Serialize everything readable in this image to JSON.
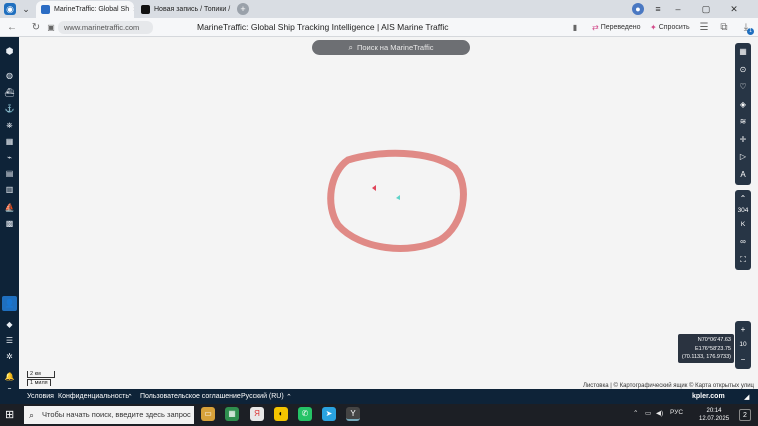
{
  "browser": {
    "tabs": [
      {
        "label": "MarineTraffic: Global Sh",
        "active": true
      },
      {
        "label": "Новая запись / Топики / ",
        "active": false
      }
    ],
    "new_tab_icon": "plus-icon",
    "url": "www.marinetraffic.com",
    "page_title": "MarineTraffic: Global Ship Tracking Intelligence | AIS Marine Traffic",
    "translated_label": "Переведено",
    "ask_label": "Спросить",
    "download_badge": "1"
  },
  "sidebar": {
    "items": [
      "logo-icon",
      "globe-icon",
      "ship-icon",
      "anchor-icon",
      "port-icon",
      "fleet-icon",
      "route-icon",
      "vessel-list-icon",
      "fleet-list-icon",
      "voyage-icon",
      "table-icon"
    ],
    "bottom_items": [
      "user-icon",
      "tag-icon",
      "layers-icon",
      "settings-icon",
      "notification-icon",
      "help-icon"
    ]
  },
  "search": {
    "placeholder": "Поиск на MarineTraffic"
  },
  "map": {
    "annotation_color": "#e08a86",
    "vessel_colors": [
      "#e0455a",
      "#5fd3c9"
    ]
  },
  "right_toolbar": {
    "zoom_in": "+",
    "zoom_level": "10",
    "zoom_out": "−",
    "heading_value": "304",
    "heading_unit": "K"
  },
  "coords": {
    "line1": "N70°06'47.63",
    "line2": "E176°58'23.75",
    "line3": "(70.1133, 176.9733)"
  },
  "scale": {
    "km": "2 км",
    "miles": "1 миля"
  },
  "attribution": "Листовка | © Картографический ящик © Карта открытых улиц",
  "footer": {
    "links": [
      "Условия",
      "Конфиденциальность",
      "Пользовательское соглашение",
      "Русский (RU)"
    ],
    "brand": "kpler.com"
  },
  "taskbar": {
    "search_placeholder": "Чтобы начать поиск, введите здесь запрос",
    "time": "20:14",
    "date": "12.07.2025",
    "lang": "РУС",
    "notif_count": "2"
  }
}
